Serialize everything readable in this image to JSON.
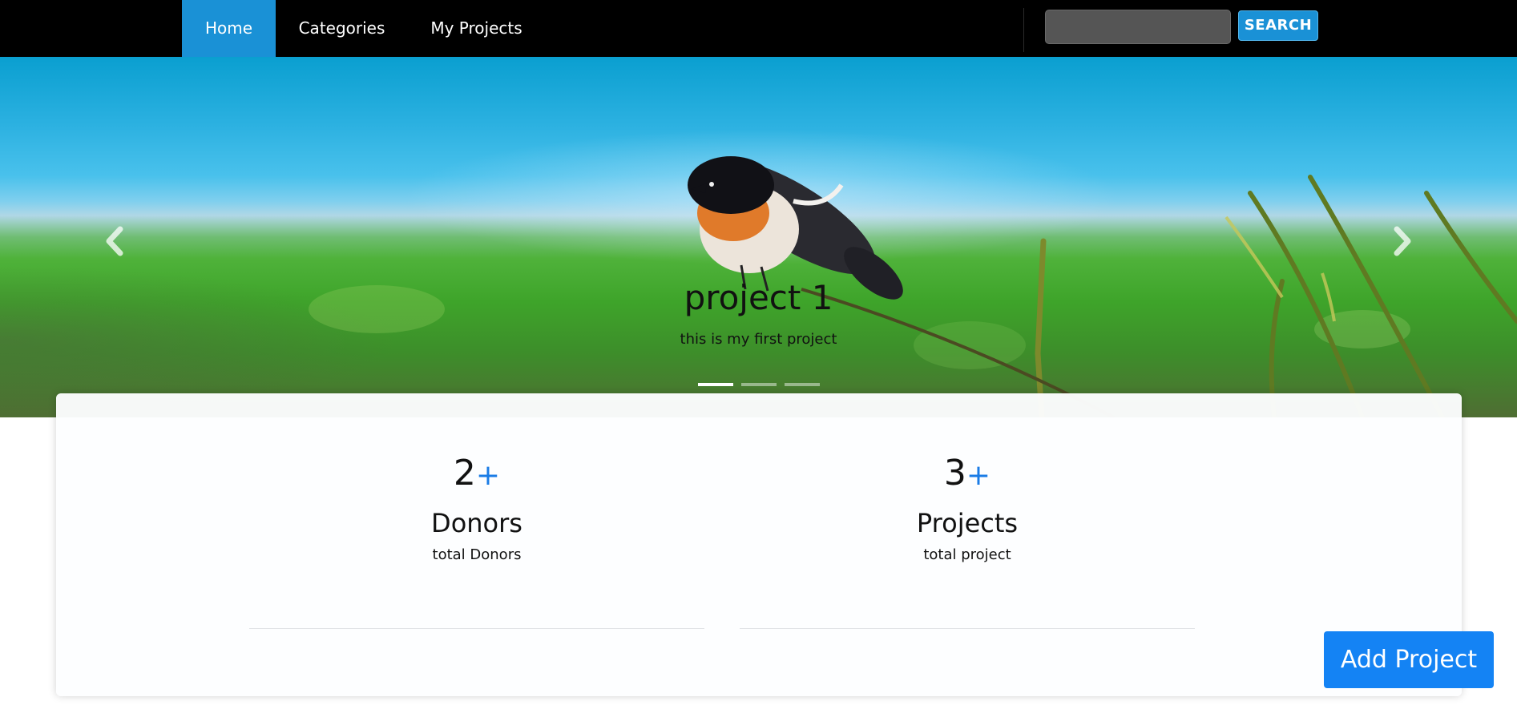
{
  "navbar": {
    "items": [
      {
        "label": "Home",
        "active": true
      },
      {
        "label": "Categories",
        "active": false
      },
      {
        "label": "My Projects",
        "active": false
      }
    ],
    "search": {
      "value": "",
      "placeholder": "",
      "button_label": "SEARCH"
    }
  },
  "carousel": {
    "title": "project 1",
    "subtitle": "this is my first project",
    "slides_count": 3,
    "active_slide": 1,
    "prev_icon": "chevron-left-icon",
    "next_icon": "chevron-right-icon"
  },
  "stats": [
    {
      "number": "2",
      "plus": "+",
      "title": "Donors",
      "subtitle": "total Donors"
    },
    {
      "number": "3",
      "plus": "+",
      "title": "Projects",
      "subtitle": "total project"
    }
  ],
  "add_project_label": "Add Project",
  "colors": {
    "navbar_bg": "#000000",
    "active_nav": "#1a91d6",
    "accent_plus": "#1a7ce6",
    "add_button": "#1483f4"
  }
}
